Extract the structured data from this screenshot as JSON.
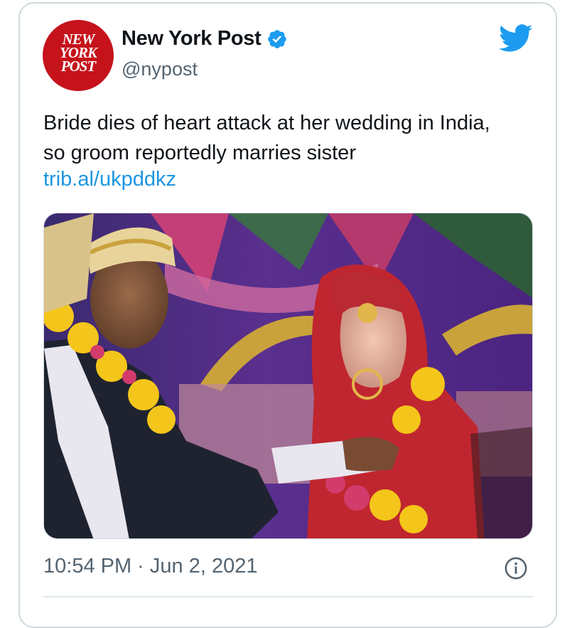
{
  "account": {
    "display_name": "New York Post",
    "handle": "@nypost",
    "avatar_text": [
      "NEW",
      "YORK",
      "POST"
    ],
    "verified": true,
    "avatar_color": "#c5121b",
    "verified_color": "#1d9bf0"
  },
  "tweet": {
    "text_lines": [
      "Bride dies of heart attack at her wedding in India,",
      "so groom reportedly marries sister"
    ],
    "link_text": "trib.al/ukpddkz",
    "link_color": "#1b95e0",
    "timestamp": "10:54 PM · Jun 2, 2021"
  },
  "icons": {
    "brand": "twitter-bird-icon",
    "info": "info-icon",
    "verified": "verified-badge-icon"
  },
  "colors": {
    "brand_blue": "#1d9bf0",
    "text": "#0f1419",
    "secondary": "#536471"
  }
}
